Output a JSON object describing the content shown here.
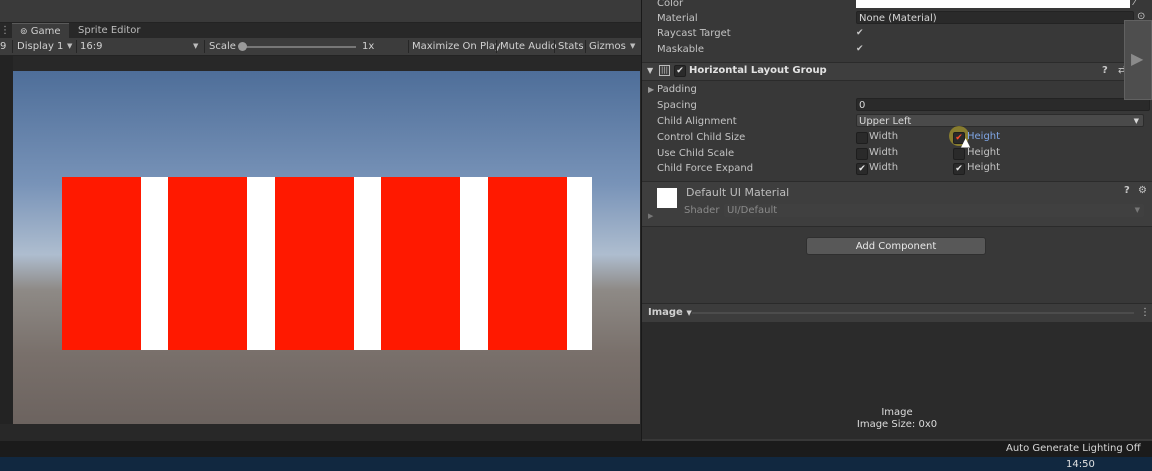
{
  "game_view": {
    "tabs": [
      {
        "label": "Game",
        "icon": "gamepad-icon"
      },
      {
        "label": "Sprite Editor"
      }
    ],
    "toolbar": {
      "display": "Display 1",
      "aspect": "16:9",
      "scale_label": "Scale",
      "scale_value": "1x",
      "scale_slider_fraction": 0.0,
      "maximize_on_play": "Maximize On Play",
      "mute_audio": "Mute Audio",
      "stats": "Stats",
      "gizmos": "Gizmos"
    },
    "canvas": {
      "bar_color": "#ff1900",
      "gap_color": "#ffffff",
      "bar_count": 5
    }
  },
  "inspector": {
    "image_props": [
      {
        "label": "Color",
        "value": ""
      },
      {
        "label": "Material",
        "value": "None (Material)"
      },
      {
        "label": "Raycast Target",
        "checked": true
      },
      {
        "label": "Maskable",
        "checked": true
      }
    ],
    "layout_group": {
      "title": "Horizontal Layout Group",
      "enabled": true,
      "padding_label": "Padding",
      "spacing_label": "Spacing",
      "spacing_value": "0",
      "child_alignment_label": "Child Alignment",
      "child_alignment_value": "Upper Left",
      "control_child_size": {
        "label": "Control Child Size",
        "width_label": "Width",
        "width": false,
        "height_label": "Height",
        "height": true
      },
      "use_child_scale": {
        "label": "Use Child Scale",
        "width_label": "Width",
        "width": false,
        "height_label": "Height",
        "height": false
      },
      "child_force_expand": {
        "label": "Child Force Expand",
        "width_label": "Width",
        "width": true,
        "height_label": "Height",
        "height": true
      }
    },
    "material": {
      "name": "Default UI Material",
      "shader_label": "Shader",
      "shader_value": "UI/Default"
    },
    "add_component": "Add Component",
    "preview": {
      "dropdown": "Image",
      "title": "Image",
      "size": "Image Size: 0x0"
    }
  },
  "status": {
    "lighting": "Auto Generate Lighting Off",
    "clock": "14:50"
  },
  "colors": {
    "panel_dark": "#282828",
    "inspector_bg": "#383838",
    "accent_link": "#7fa6e6"
  }
}
